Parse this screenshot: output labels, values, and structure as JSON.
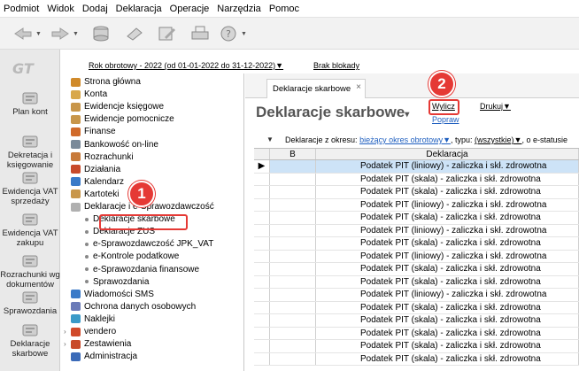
{
  "menu": [
    "Podmiot",
    "Widok",
    "Dodaj",
    "Deklaracja",
    "Operacje",
    "Narzędzia",
    "Pomoc"
  ],
  "header": {
    "rok": "Rok obrotowy - 2022  (od 01-01-2022 do 31-12-2022)▼",
    "blokady": "Brak blokady"
  },
  "leftnav": [
    {
      "label": "Plan kont",
      "icon": "books-icon"
    },
    {
      "label": "Dekretacja i księgowanie",
      "icon": "pen-icon"
    },
    {
      "label": "Ewidencja VAT sprzedaży",
      "icon": "register-icon"
    },
    {
      "label": "Ewidencja VAT zakupu",
      "icon": "register-icon"
    },
    {
      "label": "Rozrachunki wg dokumentów",
      "icon": "settlement-icon"
    },
    {
      "label": "Sprawozdania",
      "icon": "report-icon"
    },
    {
      "label": "Deklaracje skarbowe",
      "icon": "declaration-icon"
    }
  ],
  "tree": [
    {
      "label": "Strona główna",
      "level": 0,
      "icon": "home-icon",
      "color": "#d08a2a"
    },
    {
      "label": "Konta",
      "level": 0,
      "icon": "folder-icon",
      "color": "#d8a84a"
    },
    {
      "label": "Ewidencje księgowe",
      "level": 0,
      "icon": "ledger-icon",
      "color": "#c8964a"
    },
    {
      "label": "Ewidencje pomocnicze",
      "level": 0,
      "icon": "ledger-icon",
      "color": "#c8964a"
    },
    {
      "label": "Finanse",
      "level": 0,
      "icon": "finance-icon",
      "color": "#d06a2a"
    },
    {
      "label": "Bankowość on-line",
      "level": 0,
      "icon": "bank-icon",
      "color": "#7a8a9a"
    },
    {
      "label": "Rozrachunki",
      "level": 0,
      "icon": "settlement-icon",
      "color": "#c87a3a"
    },
    {
      "label": "Działania",
      "level": 0,
      "icon": "actions-icon",
      "color": "#c84a2a"
    },
    {
      "label": "Kalendarz",
      "level": 0,
      "icon": "calendar-icon",
      "color": "#3a7ac8"
    },
    {
      "label": "Kartoteki",
      "level": 0,
      "icon": "cards-icon",
      "color": "#c8964a"
    },
    {
      "label": "Deklaracje i e-Sprawozdawczość",
      "level": 0,
      "icon": "declaration-icon",
      "color": "#b0b0b0",
      "expanded": true
    },
    {
      "label": "Deklaracje skarbowe",
      "level": 1,
      "icon": "bullet-icon",
      "highlighted": true
    },
    {
      "label": "Deklaracje ZUS",
      "level": 1,
      "icon": "bullet-icon"
    },
    {
      "label": "e-Sprawozdawczość JPK_VAT",
      "level": 1,
      "icon": "bullet-icon"
    },
    {
      "label": "e-Kontrole podatkowe",
      "level": 1,
      "icon": "bullet-icon"
    },
    {
      "label": "e-Sprawozdania finansowe",
      "level": 1,
      "icon": "bullet-icon"
    },
    {
      "label": "Sprawozdania",
      "level": 1,
      "icon": "bullet-icon"
    },
    {
      "label": "Wiadomości SMS",
      "level": 0,
      "icon": "sms-icon",
      "color": "#3a7ac8"
    },
    {
      "label": "Ochrona danych osobowych",
      "level": 0,
      "icon": "shield-icon",
      "color": "#6a7ab8"
    },
    {
      "label": "Naklejki",
      "level": 0,
      "icon": "sticker-icon",
      "color": "#3a9ac8"
    },
    {
      "label": "vendero",
      "level": 0,
      "icon": "vendero-icon",
      "color": "#d04a2a"
    },
    {
      "label": "Zestawienia",
      "level": 0,
      "icon": "summary-icon",
      "color": "#c84a2a",
      "collapsed": true
    },
    {
      "label": "Administracja",
      "level": 0,
      "icon": "admin-icon",
      "color": "#3a6ab8"
    }
  ],
  "tab": {
    "label": "Deklaracje skarbowe",
    "close": "×"
  },
  "main": {
    "title": "Deklaracje skarbowe",
    "title_caret": "▾",
    "wylicz": "Wylicz",
    "popraw": "Popraw",
    "drukuj": "Drukuj▼",
    "filter_caret": "▼",
    "filter_label": "Deklaracje z okresu:",
    "filter_period": "bieżący okres obrotowy▼",
    "filter_type_label": ", typu:",
    "filter_type": "(wszystkie)▼",
    "filter_rest": ", o e-statusie"
  },
  "grid": {
    "columns": [
      "",
      "B",
      "Deklaracja"
    ],
    "rows": [
      "Podatek PIT (liniowy) - zaliczka i skł. zdrowotna",
      "Podatek PIT (skala) - zaliczka i skł. zdrowotna",
      "Podatek PIT (skala) - zaliczka i skł. zdrowotna",
      "Podatek PIT (liniowy) - zaliczka i skł. zdrowotna",
      "Podatek PIT (skala) - zaliczka i skł. zdrowotna",
      "Podatek PIT (liniowy) - zaliczka i skł. zdrowotna",
      "Podatek PIT (skala) - zaliczka i skł. zdrowotna",
      "Podatek PIT (liniowy) - zaliczka i skł. zdrowotna",
      "Podatek PIT (skala) - zaliczka i skł. zdrowotna",
      "Podatek PIT (skala) - zaliczka i skł. zdrowotna",
      "Podatek PIT (liniowy) - zaliczka i skł. zdrowotna",
      "Podatek PIT (skala) - zaliczka i skł. zdrowotna",
      "Podatek PIT (skala) - zaliczka i skł. zdrowotna",
      "Podatek PIT (skala) - zaliczka i skł. zdrowotna",
      "Podatek PIT (skala) - zaliczka i skł. zdrowotna",
      "Podatek PIT (skala) - zaliczka i skł. zdrowotna"
    ],
    "selected_marker": "▶"
  },
  "annotations": {
    "one": "1",
    "two": "2"
  },
  "colors": {
    "accent": "#e53935",
    "selected_row": "#cde3f7",
    "link": "#1f5fbf"
  }
}
